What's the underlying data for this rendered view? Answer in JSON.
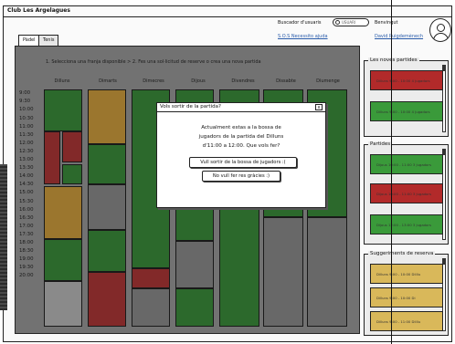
{
  "app": {
    "title": "Club Les Argelagues"
  },
  "header": {
    "search_label": "Buscador d'usuaris",
    "search_placeholder": "USUARI",
    "sos_link": "S.O.S Necessito ajuda",
    "welcome": "Benvingut",
    "user_name": "David Puigdemènech"
  },
  "tabs": [
    {
      "label": "Pàdel",
      "active": true
    },
    {
      "label": "Tenis",
      "active": false
    }
  ],
  "main": {
    "instructions": "1. Selecciona una franja disponible > 2. Fes una sol·licitud de reserve o crea una nova partida",
    "days": [
      "Dilluns",
      "Dimarts",
      "Dimecres",
      "Dijous",
      "Divendres",
      "Dissabte",
      "Diumenge"
    ],
    "times": [
      "9:00",
      "9:30",
      "10:00",
      "10:30",
      "11:00",
      "11:30",
      "12:00",
      "12:30",
      "13:00",
      "13:30",
      "14:00",
      "14:30",
      "15:00",
      "15:30",
      "16:00",
      "16:30",
      "17:00",
      "17:30",
      "18:00",
      "18:30",
      "19:00",
      "19:30",
      "20:00"
    ]
  },
  "legend_colors": {
    "available": "#2e8c2e",
    "pending": "#d9a032",
    "full": "#b22a2a",
    "closed": "#8a8a8a"
  },
  "panels": {
    "noves_partides": {
      "title": "Les noves partides",
      "cards": [
        {
          "text": "Dilluns 9:00 - 10:00 4 jugadors"
        },
        {
          "text": "Dilluns 9:00 - 10:00 4 jugadors"
        }
      ]
    },
    "partides": {
      "title": "Partides",
      "cards": [
        {
          "text": "Dijous 10:00 - 11:00 3 jugadors"
        },
        {
          "text": "Dijous 10:00 - 11:00 3 jugadors"
        },
        {
          "text": "Dijous 12:00 - 13:00 3 jugadors"
        }
      ]
    },
    "suggeriments": {
      "title": "Suggeriments de reserva",
      "cards": [
        {
          "text": "Dilluns 9:00 - 10:00 Dilllu"
        },
        {
          "text": "Dilluns 9:00 - 10:00 Di"
        },
        {
          "text": "Dilluns 9:00 - 11:00 Dilllu"
        }
      ]
    }
  },
  "dialog": {
    "title": "Vols sortir de la partida?",
    "close_label": "x",
    "message_line1": "Actualment estas a la bossa de",
    "message_line2": "jugadors de la partida del Dilluns",
    "message_line3": "d'11:00 a 12:00. Que vols fer?",
    "confirm_label": "Vull sortir de la bossa de jugadors :(",
    "cancel_label": "No vull fer res gràcies :)"
  }
}
